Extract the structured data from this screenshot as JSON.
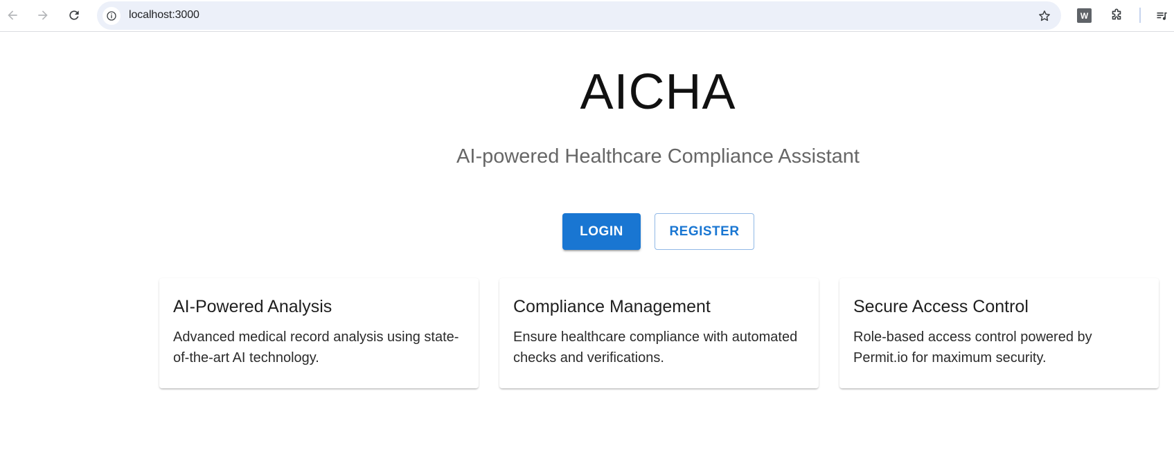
{
  "browser": {
    "url": "localhost:3000",
    "icons": {
      "back": "arrow-left-icon",
      "forward": "arrow-right-icon",
      "reload": "reload-icon",
      "site_info": "info-icon",
      "bookmark": "star-icon",
      "extension_w": "W",
      "extensions": "puzzle-icon",
      "media": "media-queue-icon"
    }
  },
  "hero": {
    "title": "AICHA",
    "subtitle": "AI-powered Healthcare Compliance Assistant"
  },
  "actions": {
    "login_label": "LOGIN",
    "register_label": "REGISTER"
  },
  "features": [
    {
      "title": "AI-Powered Analysis",
      "description": "Advanced medical record analysis using state-of-the-art AI technology."
    },
    {
      "title": "Compliance Management",
      "description": "Ensure healthcare compliance with automated checks and verifications."
    },
    {
      "title": "Secure Access Control",
      "description": "Role-based access control powered by Permit.io for maximum security."
    }
  ],
  "colors": {
    "primary": "#1976d2",
    "subtitle": "#666666",
    "omnibox_bg": "#ecf0f9"
  }
}
